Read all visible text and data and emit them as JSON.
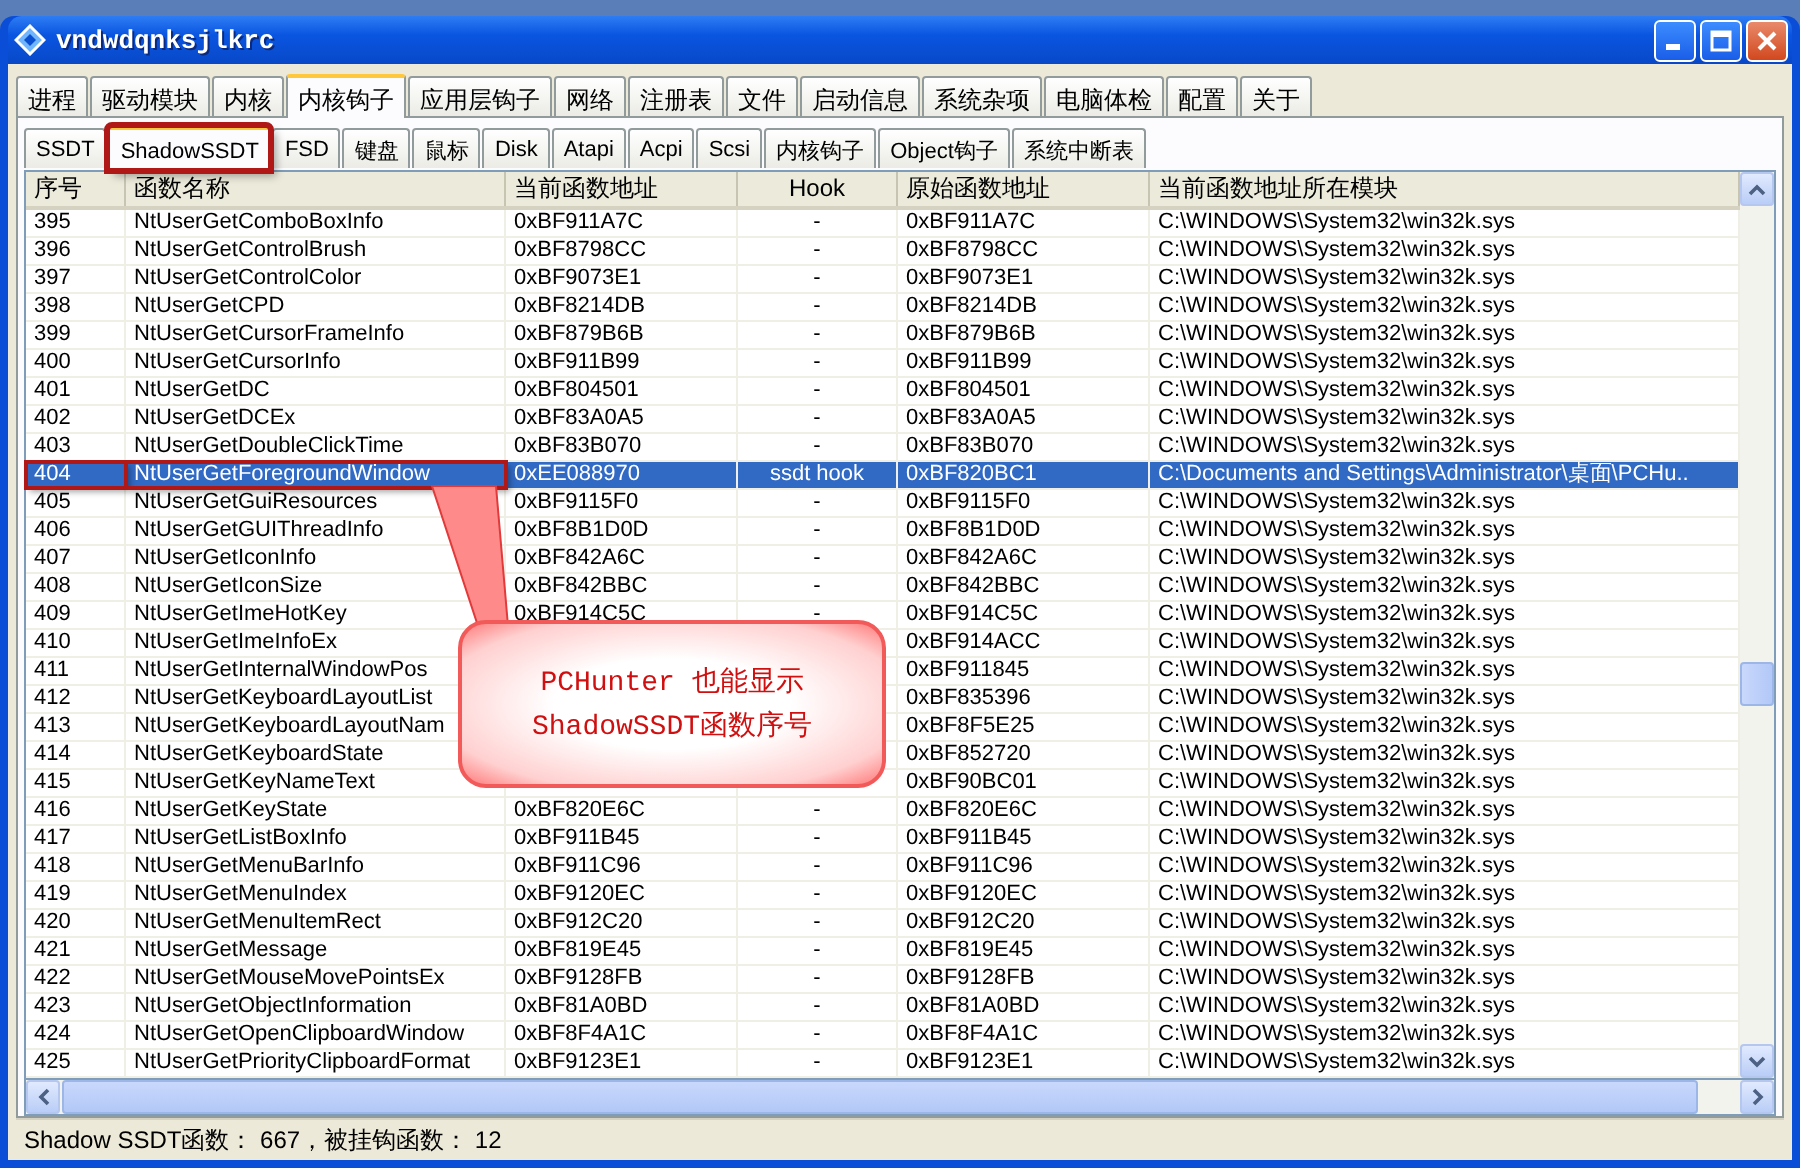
{
  "window": {
    "title": "vndwdqnksjlkrc"
  },
  "main_tabs": [
    {
      "label": "进程",
      "selected": false
    },
    {
      "label": "驱动模块",
      "selected": false
    },
    {
      "label": "内核",
      "selected": false
    },
    {
      "label": "内核钩子",
      "selected": true
    },
    {
      "label": "应用层钩子",
      "selected": false
    },
    {
      "label": "网络",
      "selected": false
    },
    {
      "label": "注册表",
      "selected": false
    },
    {
      "label": "文件",
      "selected": false
    },
    {
      "label": "启动信息",
      "selected": false
    },
    {
      "label": "系统杂项",
      "selected": false
    },
    {
      "label": "电脑体检",
      "selected": false
    },
    {
      "label": "配置",
      "selected": false
    },
    {
      "label": "关于",
      "selected": false
    }
  ],
  "sub_tabs": [
    {
      "label": "SSDT",
      "selected": false,
      "boxed": false
    },
    {
      "label": "ShadowSSDT",
      "selected": true,
      "boxed": true
    },
    {
      "label": "FSD",
      "selected": false,
      "boxed": false
    },
    {
      "label": "键盘",
      "selected": false,
      "boxed": false
    },
    {
      "label": "鼠标",
      "selected": false,
      "boxed": false
    },
    {
      "label": "Disk",
      "selected": false,
      "boxed": false
    },
    {
      "label": "Atapi",
      "selected": false,
      "boxed": false
    },
    {
      "label": "Acpi",
      "selected": false,
      "boxed": false
    },
    {
      "label": "Scsi",
      "selected": false,
      "boxed": false
    },
    {
      "label": "内核钩子",
      "selected": false,
      "boxed": false
    },
    {
      "label": "Object钩子",
      "selected": false,
      "boxed": false
    },
    {
      "label": "系统中断表",
      "selected": false,
      "boxed": false
    }
  ],
  "table": {
    "columns": [
      "序号",
      "函数名称",
      "当前函数地址",
      "Hook",
      "原始函数地址",
      "当前函数地址所在模块"
    ],
    "rows": [
      {
        "index": "395",
        "name": "NtUserGetComboBoxInfo",
        "current": "0xBF911A7C",
        "hook": "-",
        "original": "0xBF911A7C",
        "module": "C:\\WINDOWS\\System32\\win32k.sys",
        "selected": false,
        "boxed": false
      },
      {
        "index": "396",
        "name": "NtUserGetControlBrush",
        "current": "0xBF8798CC",
        "hook": "-",
        "original": "0xBF8798CC",
        "module": "C:\\WINDOWS\\System32\\win32k.sys",
        "selected": false,
        "boxed": false
      },
      {
        "index": "397",
        "name": "NtUserGetControlColor",
        "current": "0xBF9073E1",
        "hook": "-",
        "original": "0xBF9073E1",
        "module": "C:\\WINDOWS\\System32\\win32k.sys",
        "selected": false,
        "boxed": false
      },
      {
        "index": "398",
        "name": "NtUserGetCPD",
        "current": "0xBF8214DB",
        "hook": "-",
        "original": "0xBF8214DB",
        "module": "C:\\WINDOWS\\System32\\win32k.sys",
        "selected": false,
        "boxed": false
      },
      {
        "index": "399",
        "name": "NtUserGetCursorFrameInfo",
        "current": "0xBF879B6B",
        "hook": "-",
        "original": "0xBF879B6B",
        "module": "C:\\WINDOWS\\System32\\win32k.sys",
        "selected": false,
        "boxed": false
      },
      {
        "index": "400",
        "name": "NtUserGetCursorInfo",
        "current": "0xBF911B99",
        "hook": "-",
        "original": "0xBF911B99",
        "module": "C:\\WINDOWS\\System32\\win32k.sys",
        "selected": false,
        "boxed": false
      },
      {
        "index": "401",
        "name": "NtUserGetDC",
        "current": "0xBF804501",
        "hook": "-",
        "original": "0xBF804501",
        "module": "C:\\WINDOWS\\System32\\win32k.sys",
        "selected": false,
        "boxed": false
      },
      {
        "index": "402",
        "name": "NtUserGetDCEx",
        "current": "0xBF83A0A5",
        "hook": "-",
        "original": "0xBF83A0A5",
        "module": "C:\\WINDOWS\\System32\\win32k.sys",
        "selected": false,
        "boxed": false
      },
      {
        "index": "403",
        "name": "NtUserGetDoubleClickTime",
        "current": "0xBF83B070",
        "hook": "-",
        "original": "0xBF83B070",
        "module": "C:\\WINDOWS\\System32\\win32k.sys",
        "selected": false,
        "boxed": false
      },
      {
        "index": "404",
        "name": "NtUserGetForegroundWindow",
        "current": "0xEE088970",
        "hook": "ssdt hook",
        "original": "0xBF820BC1",
        "module": "C:\\Documents and Settings\\Administrator\\桌面\\PCHu..",
        "selected": true,
        "boxed": true
      },
      {
        "index": "405",
        "name": "NtUserGetGuiResources",
        "current": "0xBF9115F0",
        "hook": "-",
        "original": "0xBF9115F0",
        "module": "C:\\WINDOWS\\System32\\win32k.sys",
        "selected": false,
        "boxed": false
      },
      {
        "index": "406",
        "name": "NtUserGetGUIThreadInfo",
        "current": "0xBF8B1D0D",
        "hook": "-",
        "original": "0xBF8B1D0D",
        "module": "C:\\WINDOWS\\System32\\win32k.sys",
        "selected": false,
        "boxed": false
      },
      {
        "index": "407",
        "name": "NtUserGetIconInfo",
        "current": "0xBF842A6C",
        "hook": "-",
        "original": "0xBF842A6C",
        "module": "C:\\WINDOWS\\System32\\win32k.sys",
        "selected": false,
        "boxed": false
      },
      {
        "index": "408",
        "name": "NtUserGetIconSize",
        "current": "0xBF842BBC",
        "hook": "-",
        "original": "0xBF842BBC",
        "module": "C:\\WINDOWS\\System32\\win32k.sys",
        "selected": false,
        "boxed": false
      },
      {
        "index": "409",
        "name": "NtUserGetImeHotKey",
        "current": "0xBF914C5C",
        "hook": "-",
        "original": "0xBF914C5C",
        "module": "C:\\WINDOWS\\System32\\win32k.sys",
        "selected": false,
        "boxed": false
      },
      {
        "index": "410",
        "name": "NtUserGetImeInfoEx",
        "original": "0xBF914ACC",
        "module": "C:\\WINDOWS\\System32\\win32k.sys",
        "selected": false,
        "boxed": false
      },
      {
        "index": "411",
        "name": "NtUserGetInternalWindowPos",
        "original": "0xBF911845",
        "module": "C:\\WINDOWS\\System32\\win32k.sys",
        "selected": false,
        "boxed": false
      },
      {
        "index": "412",
        "name": "NtUserGetKeyboardLayoutList",
        "original": "0xBF835396",
        "module": "C:\\WINDOWS\\System32\\win32k.sys",
        "selected": false,
        "boxed": false
      },
      {
        "index": "413",
        "name": "NtUserGetKeyboardLayoutNam",
        "original": "0xBF8F5E25",
        "module": "C:\\WINDOWS\\System32\\win32k.sys",
        "selected": false,
        "boxed": false
      },
      {
        "index": "414",
        "name": "NtUserGetKeyboardState",
        "original": "0xBF852720",
        "module": "C:\\WINDOWS\\System32\\win32k.sys",
        "selected": false,
        "boxed": false
      },
      {
        "index": "415",
        "name": "NtUserGetKeyNameText",
        "original": "0xBF90BC01",
        "module": "C:\\WINDOWS\\System32\\win32k.sys",
        "selected": false,
        "boxed": false
      },
      {
        "index": "416",
        "name": "NtUserGetKeyState",
        "current": "0xBF820E6C",
        "hook": "-",
        "original": "0xBF820E6C",
        "module": "C:\\WINDOWS\\System32\\win32k.sys",
        "selected": false,
        "boxed": false
      },
      {
        "index": "417",
        "name": "NtUserGetListBoxInfo",
        "current": "0xBF911B45",
        "hook": "-",
        "original": "0xBF911B45",
        "module": "C:\\WINDOWS\\System32\\win32k.sys",
        "selected": false,
        "boxed": false
      },
      {
        "index": "418",
        "name": "NtUserGetMenuBarInfo",
        "current": "0xBF911C96",
        "hook": "-",
        "original": "0xBF911C96",
        "module": "C:\\WINDOWS\\System32\\win32k.sys",
        "selected": false,
        "boxed": false
      },
      {
        "index": "419",
        "name": "NtUserGetMenuIndex",
        "current": "0xBF9120EC",
        "hook": "-",
        "original": "0xBF9120EC",
        "module": "C:\\WINDOWS\\System32\\win32k.sys",
        "selected": false,
        "boxed": false
      },
      {
        "index": "420",
        "name": "NtUserGetMenuItemRect",
        "current": "0xBF912C20",
        "hook": "-",
        "original": "0xBF912C20",
        "module": "C:\\WINDOWS\\System32\\win32k.sys",
        "selected": false,
        "boxed": false
      },
      {
        "index": "421",
        "name": "NtUserGetMessage",
        "current": "0xBF819E45",
        "hook": "-",
        "original": "0xBF819E45",
        "module": "C:\\WINDOWS\\System32\\win32k.sys",
        "selected": false,
        "boxed": false
      },
      {
        "index": "422",
        "name": "NtUserGetMouseMovePointsEx",
        "current": "0xBF9128FB",
        "hook": "-",
        "original": "0xBF9128FB",
        "module": "C:\\WINDOWS\\System32\\win32k.sys",
        "selected": false,
        "boxed": false
      },
      {
        "index": "423",
        "name": "NtUserGetObjectInformation",
        "current": "0xBF81A0BD",
        "hook": "-",
        "original": "0xBF81A0BD",
        "module": "C:\\WINDOWS\\System32\\win32k.sys",
        "selected": false,
        "boxed": false
      },
      {
        "index": "424",
        "name": "NtUserGetOpenClipboardWindow",
        "current": "0xBF8F4A1C",
        "hook": "-",
        "original": "0xBF8F4A1C",
        "module": "C:\\WINDOWS\\System32\\win32k.sys",
        "selected": false,
        "boxed": false
      },
      {
        "index": "425",
        "name": "NtUserGetPriorityClipboardFormat",
        "current": "0xBF9123E1",
        "hook": "-",
        "original": "0xBF9123E1",
        "module": "C:\\WINDOWS\\System32\\win32k.sys",
        "selected": false,
        "boxed": false
      }
    ]
  },
  "callout": {
    "lines": [
      "PCHunter 也能显示",
      "ShadowSSDT函数序号"
    ]
  },
  "status_bar": "Shadow SSDT函数： 667，被挂钩函数： 12"
}
